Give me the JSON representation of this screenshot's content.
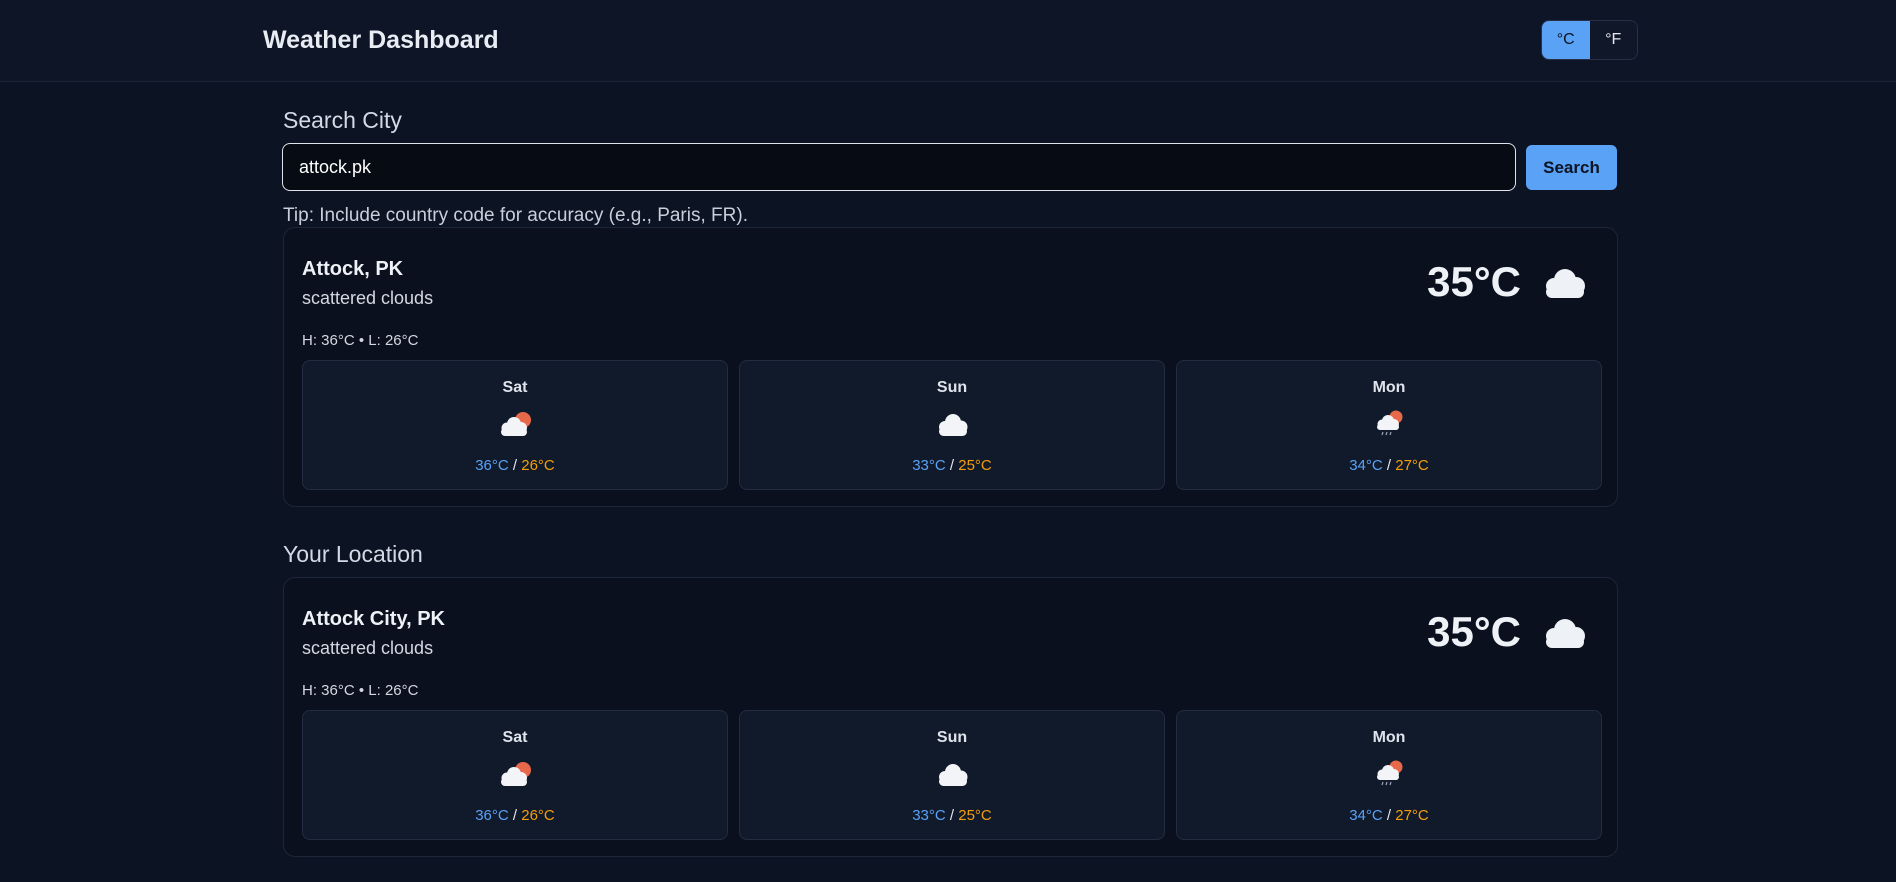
{
  "header": {
    "title": "Weather Dashboard",
    "units": [
      {
        "label": "°C",
        "active": true
      },
      {
        "label": "°F",
        "active": false
      }
    ]
  },
  "search": {
    "heading": "Search City",
    "value": "attock.pk",
    "button_label": "Search",
    "tip": "Tip: Include country code for accuracy (e.g., Paris, FR)."
  },
  "searched": {
    "city": "Attock, PK",
    "description": "scattered clouds",
    "temp": "35°C",
    "icon": "cloud-icon",
    "hilo": "H: 36°C • L: 26°C",
    "forecast": [
      {
        "day": "Sat",
        "icon": "cloud-sun-icon",
        "high": "36°C",
        "low": "26°C"
      },
      {
        "day": "Sun",
        "icon": "cloud-icon",
        "high": "33°C",
        "low": "25°C"
      },
      {
        "day": "Mon",
        "icon": "cloud-sun-rain-icon",
        "high": "34°C",
        "low": "27°C"
      }
    ]
  },
  "location": {
    "heading": "Your Location",
    "city": "Attock City, PK",
    "description": "scattered clouds",
    "temp": "35°C",
    "icon": "cloud-icon",
    "hilo": "H: 36°C • L: 26°C",
    "forecast": [
      {
        "day": "Sat",
        "icon": "cloud-sun-icon",
        "high": "36°C",
        "low": "26°C"
      },
      {
        "day": "Sun",
        "icon": "cloud-icon",
        "high": "33°C",
        "low": "25°C"
      },
      {
        "day": "Mon",
        "icon": "cloud-sun-rain-icon",
        "high": "34°C",
        "low": "27°C"
      }
    ]
  },
  "colors": {
    "accent": "#5aa2f6",
    "high_temp": "#5aa2f6",
    "low_temp": "#f59e0b",
    "sun": "#e8684a"
  }
}
